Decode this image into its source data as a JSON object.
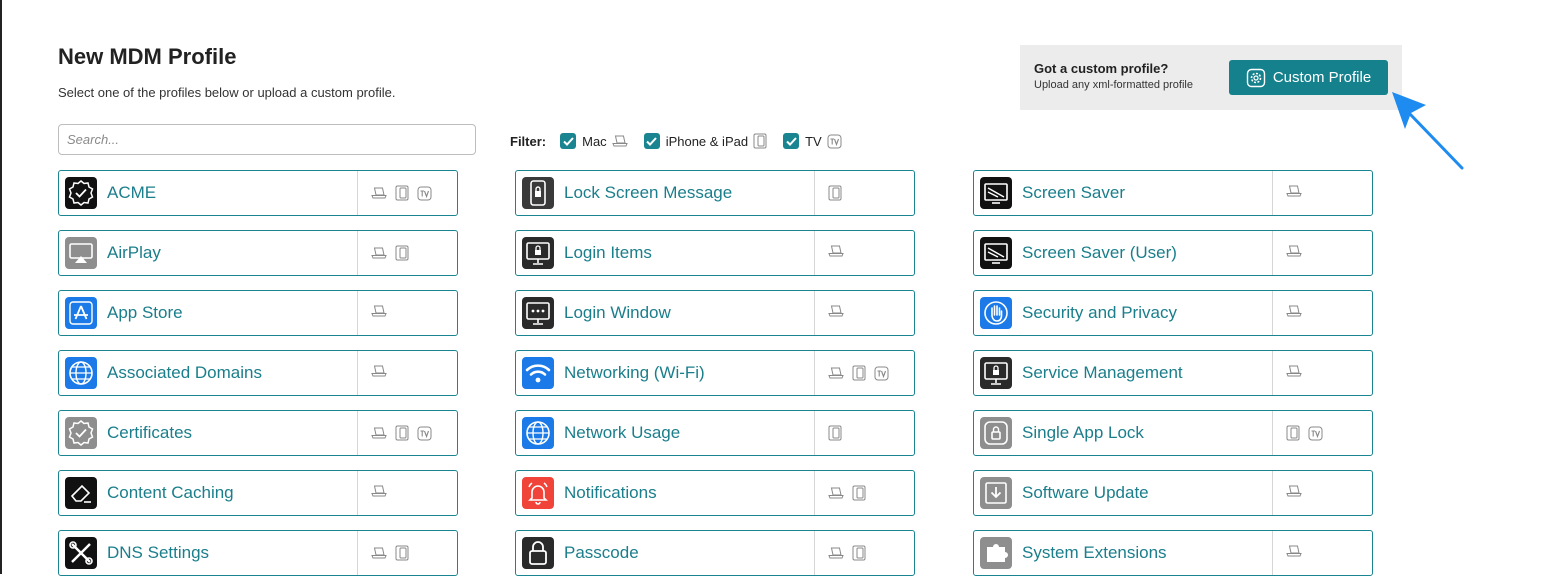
{
  "header": {
    "title": "New MDM Profile",
    "subtitle": "Select one of the profiles below or upload a custom profile."
  },
  "search": {
    "placeholder": "Search...",
    "value": ""
  },
  "filter": {
    "label": "Filter:",
    "options": [
      {
        "label": "Mac",
        "checked": true,
        "icon": "laptop-icon"
      },
      {
        "label": "iPhone & iPad",
        "checked": true,
        "icon": "phone-icon"
      },
      {
        "label": "TV",
        "checked": true,
        "icon": "tv-icon"
      }
    ]
  },
  "custom_profile": {
    "title": "Got a custom profile?",
    "subtitle": "Upload any xml-formatted profile",
    "button_label": "Custom Profile",
    "button_icon": "gear-icon"
  },
  "colors": {
    "accent": "#1a8591",
    "button": "#15818d",
    "arrow": "#1e8bf0",
    "panel": "#ececec"
  },
  "profiles": [
    {
      "name": "ACME",
      "icon": "acme-badge-icon",
      "icon_bg": "#111111",
      "platforms": [
        "mac",
        "ios",
        "tv"
      ]
    },
    {
      "name": "AirPlay",
      "icon": "airplay-icon",
      "icon_bg": "#8e8e8e",
      "platforms": [
        "mac",
        "ios"
      ]
    },
    {
      "name": "App Store",
      "icon": "app-store-icon",
      "icon_bg": "#1b7ae8",
      "platforms": [
        "mac"
      ]
    },
    {
      "name": "Associated Domains",
      "icon": "globe-icon",
      "icon_bg": "#1b7ae8",
      "platforms": [
        "mac"
      ]
    },
    {
      "name": "Certificates",
      "icon": "certificate-badge-icon",
      "icon_bg": "#8e8e8e",
      "platforms": [
        "mac",
        "ios",
        "tv"
      ]
    },
    {
      "name": "Content Caching",
      "icon": "eraser-icon",
      "icon_bg": "#111111",
      "platforms": [
        "mac"
      ]
    },
    {
      "name": "DNS Settings",
      "icon": "tools-icon",
      "icon_bg": "#111111",
      "platforms": [
        "mac",
        "ios"
      ]
    },
    {
      "name": "Lock Screen Message",
      "icon": "lock-phone-icon",
      "icon_bg": "#3a3a3a",
      "platforms": [
        "ios"
      ]
    },
    {
      "name": "Login Items",
      "icon": "lock-monitor-icon",
      "icon_bg": "#2a2a2a",
      "platforms": [
        "mac"
      ]
    },
    {
      "name": "Login Window",
      "icon": "password-monitor-icon",
      "icon_bg": "#2a2a2a",
      "platforms": [
        "mac"
      ]
    },
    {
      "name": "Networking (Wi-Fi)",
      "icon": "wifi-icon",
      "icon_bg": "#1b7ae8",
      "platforms": [
        "mac",
        "ios",
        "tv"
      ]
    },
    {
      "name": "Network Usage",
      "icon": "globe-icon",
      "icon_bg": "#1b7ae8",
      "platforms": [
        "ios"
      ]
    },
    {
      "name": "Notifications",
      "icon": "bell-icon",
      "icon_bg": "#f0443a",
      "platforms": [
        "mac",
        "ios"
      ]
    },
    {
      "name": "Passcode",
      "icon": "padlock-icon",
      "icon_bg": "#2a2a2a",
      "platforms": [
        "mac",
        "ios"
      ]
    },
    {
      "name": "Screen Saver",
      "icon": "screen-saver-icon",
      "icon_bg": "#111111",
      "platforms": [
        "mac"
      ]
    },
    {
      "name": "Screen Saver (User)",
      "icon": "screen-saver-icon",
      "icon_bg": "#111111",
      "platforms": [
        "mac"
      ]
    },
    {
      "name": "Security and Privacy",
      "icon": "hand-icon",
      "icon_bg": "#1b7ae8",
      "platforms": [
        "mac"
      ]
    },
    {
      "name": "Service Management",
      "icon": "lock-monitor-icon",
      "icon_bg": "#2a2a2a",
      "platforms": [
        "mac"
      ]
    },
    {
      "name": "Single App Lock",
      "icon": "app-lock-icon",
      "icon_bg": "#8e8e8e",
      "platforms": [
        "ios",
        "tv"
      ]
    },
    {
      "name": "Software Update",
      "icon": "download-icon",
      "icon_bg": "#8e8e8e",
      "platforms": [
        "mac"
      ]
    },
    {
      "name": "System Extensions",
      "icon": "puzzle-icon",
      "icon_bg": "#8e8e8e",
      "platforms": [
        "mac"
      ]
    }
  ]
}
